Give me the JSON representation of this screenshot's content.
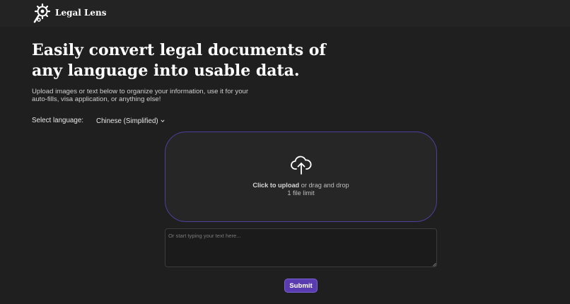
{
  "navbar": {
    "brand": "Legal Lens",
    "logo_icon": "gear-magnifier-icon"
  },
  "hero": {
    "title": "Easily convert legal documents of any language into usable data.",
    "subtitle": "Upload images or text below to organize your information, use it for your auto-fills, visa application, or anything else!"
  },
  "language": {
    "label": "Select language:",
    "selected": "Chinese (Simplified)",
    "chevron_icon": "chevron-down-icon"
  },
  "upload": {
    "icon": "cloud-upload-icon",
    "click_text": "Click to upload",
    "drag_text": " or drag and drop",
    "limit_text": "1 file limit"
  },
  "text_input": {
    "placeholder": "Or start typing your text here...",
    "value": ""
  },
  "submit": {
    "label": "Submit"
  },
  "colors": {
    "background": "#1f1f1f",
    "accent": "#5a3cb0",
    "dropzone_border": "#4d3f9a"
  }
}
